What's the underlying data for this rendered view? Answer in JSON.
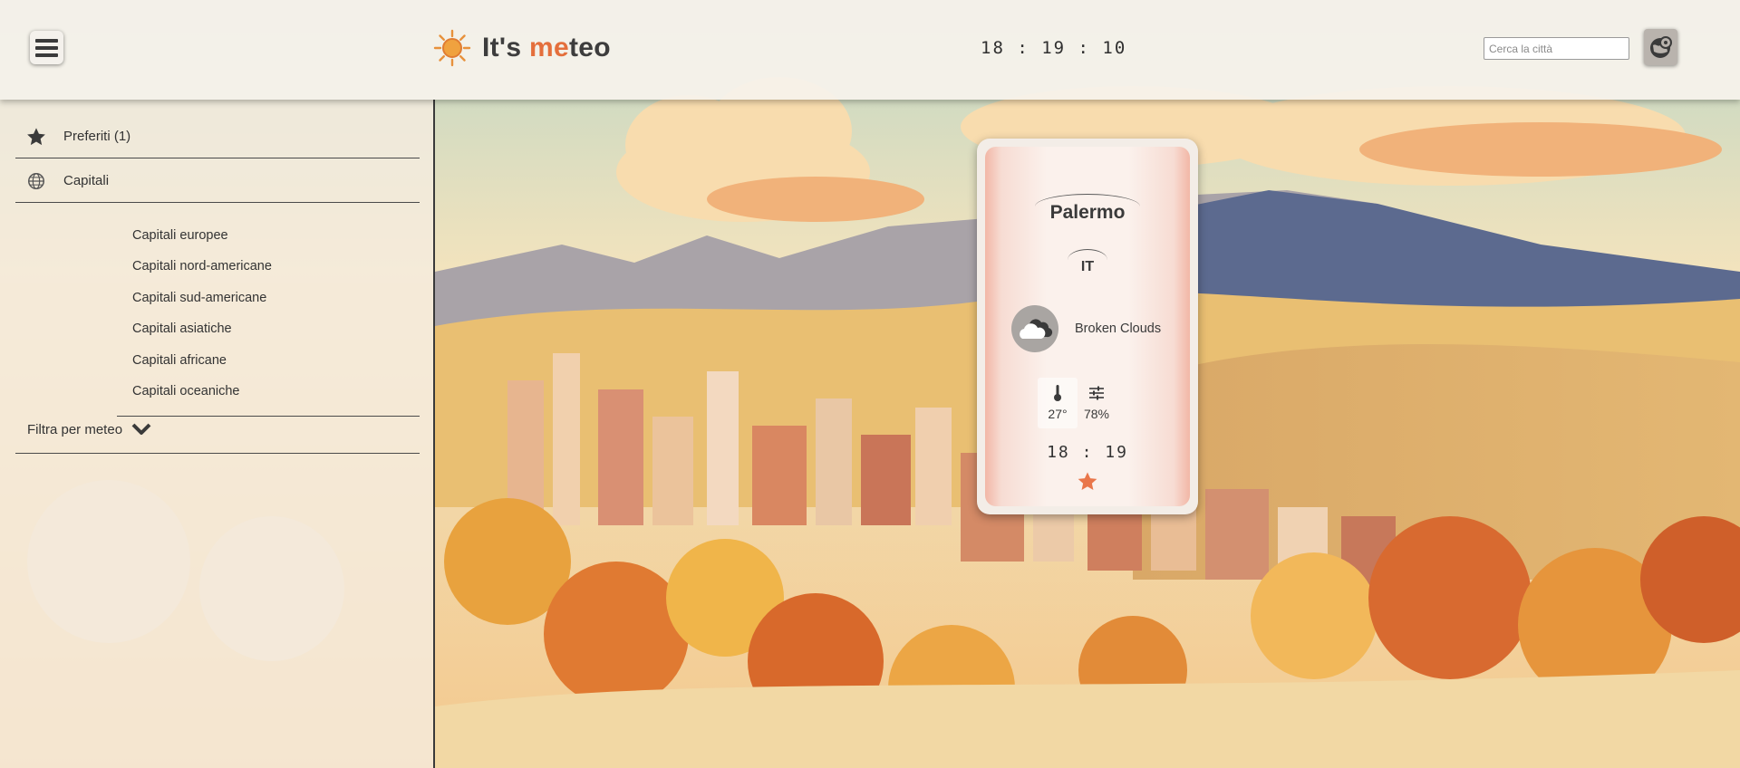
{
  "app": {
    "logo_prefix": "It's ",
    "logo_accent": "me",
    "logo_suffix": "teo",
    "accent_color": "#e46f3c"
  },
  "header": {
    "clock": "18 : 19 : 10",
    "search_placeholder": "Cerca la città",
    "menu_icon": "hamburger-icon",
    "geo_icon": "globe-location-icon"
  },
  "sidebar": {
    "favorites_label": "Preferiti (1)",
    "favorites_icon": "star-icon",
    "capitals_label": "Capitali",
    "capitals_icon": "globe-icon",
    "capital_groups": [
      "Capitali europee",
      "Capitali nord-americane",
      "Capitali sud-americane",
      "Capitali asiatiche",
      "Capitali africane",
      "Capitali oceaniche"
    ],
    "filter_label": "Filtra per meteo",
    "filter_icon": "chevron-down-icon"
  },
  "card": {
    "city": "Palermo",
    "country": "IT",
    "condition": "Broken Clouds",
    "condition_icon": "broken-clouds-icon",
    "temperature": "27°",
    "temperature_icon": "thermometer-icon",
    "humidity": "78%",
    "humidity_icon": "humidity-sliders-icon",
    "local_time": "18 : 19",
    "favorite_icon": "star-icon",
    "favorite_color": "#e9764a"
  }
}
